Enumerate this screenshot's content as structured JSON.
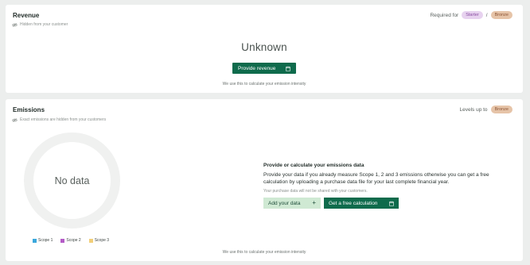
{
  "revenue": {
    "title": "Revenue",
    "subtitle": "Hidden from your customer",
    "required_label": "Required for",
    "tiers": [
      "Starter",
      "Bronze"
    ],
    "separator": "/",
    "value": "Unknown",
    "button": "Provide revenue",
    "footnote": "We use this to calculate your emission intensity"
  },
  "emissions": {
    "title": "Emissions",
    "subtitle": "Exact emissions are hidden from your customers",
    "levels_label": "Levels up to",
    "level": "Bronze",
    "donut_label": "No data",
    "legend": [
      {
        "label": "Scope 1",
        "color": "#3aa7dc"
      },
      {
        "label": "Scope 2",
        "color": "#b45bc7"
      },
      {
        "label": "Scope 3",
        "color": "#f2cf7a"
      }
    ],
    "provide_title": "Provide or calculate your emissions data",
    "provide_body": "Provide your data if you already measure Scope 1, 2 and 3 emissions otherwise you can get a free calculation by uploading a purchase data file for your last complete financial year.",
    "provide_note": "Your purchase data will not be shared with your customers.",
    "add_button": "Add your data",
    "calc_button": "Get a free calculation",
    "footnote": "We use this to calculate your emission intensity"
  },
  "colors": {
    "primary": "#0f6b4c",
    "secondary": "#cfe9d3",
    "starter_pill": "#e7d2ef",
    "bronze_pill": "#e6c4a8",
    "background": "#eceeed"
  }
}
